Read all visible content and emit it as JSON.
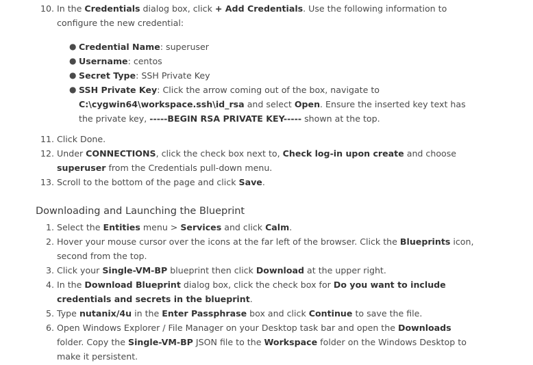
{
  "section1": {
    "step10": {
      "num": "10.",
      "t1": "In the ",
      "b1": "Credentials",
      "t2": " dialog box, click ",
      "b2": "+ Add Credentials",
      "t3": ". Use the following information to configure the new credential:"
    },
    "bullets": {
      "b1": {
        "label": "Credential Name",
        "text": ": superuser"
      },
      "b2": {
        "label": "Username",
        "text": ": centos"
      },
      "b3": {
        "label": "Secret Type",
        "text": ": SSH Private Key"
      },
      "b4": {
        "label": "SSH Private Key",
        "t1": ": Click the arrow coming out of the box, navigate to ",
        "b1": "C:\\cygwin64\\workspace.ssh\\id_rsa",
        "t2": " and select ",
        "b2": "Open",
        "t3": ". Ensure the inserted key text has the private key, ",
        "b3": "-----BEGIN RSA PRIVATE KEY-----",
        "t4": " shown at the top."
      }
    }
  },
  "section2": {
    "step11": {
      "num": "11.",
      "text": "Click Done."
    },
    "step12": {
      "num": "12.",
      "t1": "Under ",
      "b1": "CONNECTIONS",
      "t2": ", click the check box next to, ",
      "b2": "Check log-in upon create",
      "t3": " and choose ",
      "b3": "superuser",
      "t4": " from the Credentials pull-down menu."
    },
    "step13": {
      "num": "13.",
      "t1": "Scroll to the bottom of the page and click ",
      "b1": "Save",
      "t2": "."
    }
  },
  "heading": "Downloading and Launching the Blueprint",
  "section3": {
    "s1": {
      "num": "1.",
      "t1": "Select the ",
      "b1": "Entities",
      "t2": " menu > ",
      "b2": "Services",
      "t3": " and click ",
      "b3": "Calm",
      "t4": "."
    },
    "s2": {
      "num": "2.",
      "t1": "Hover your mouse cursor over the icons at the far left of the browser. Click the ",
      "b1": "Blueprints",
      "t2": " icon, second from the top."
    },
    "s3": {
      "num": "3.",
      "t1": "Click your ",
      "b1": "Single-VM-BP",
      "t2": " blueprint then click ",
      "b2": "Download",
      "t3": " at the upper right."
    },
    "s4": {
      "num": "4.",
      "t1": "In the ",
      "b1": "Download Blueprint",
      "t2": " dialog box, click the check box for ",
      "b2": "Do you want to include credentials and secrets in the blueprint",
      "t3": "."
    },
    "s5": {
      "num": "5.",
      "t1": "Type ",
      "b1": "nutanix/4u",
      "t2": " in the ",
      "b2": "Enter Passphrase",
      "t3": " box and click ",
      "b3": "Continue",
      "t4": " to save the file."
    },
    "s6": {
      "num": "6.",
      "t1": "Open Windows Explorer / File Manager on your Desktop task bar and open the ",
      "b1": "Downloads",
      "t2": " folder. Copy the ",
      "b2": "Single-VM-BP",
      "t3": " JSON file to the ",
      "b3": "Workspace",
      "t4": " folder on the Windows Desktop to make it persistent."
    }
  }
}
